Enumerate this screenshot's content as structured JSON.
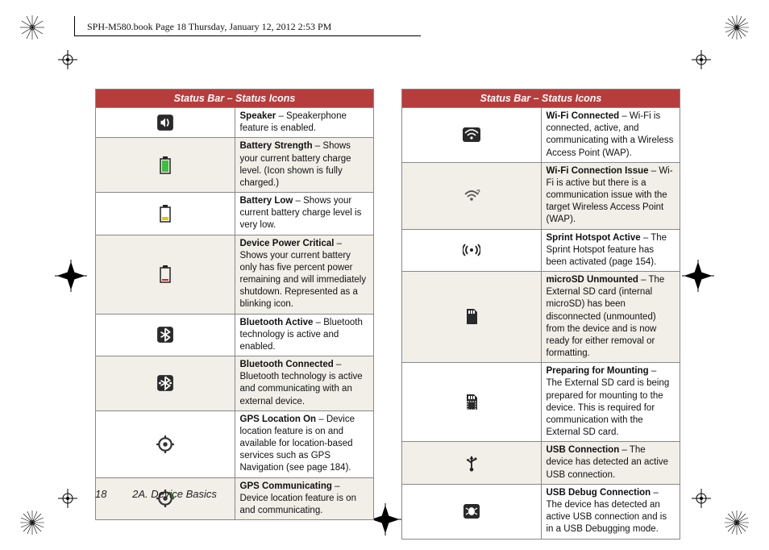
{
  "doc_tag": "SPH-M580.book  Page 18  Thursday, January 12, 2012  2:53 PM",
  "page_number": "18",
  "section": "2A. Device Basics",
  "table_header": "Status Bar – Status Icons",
  "left_rows": [
    {
      "term": "Speaker",
      "desc": " – Speakerphone feature is enabled.",
      "alt": false,
      "icon": "speaker"
    },
    {
      "term": "Battery Strength",
      "desc": " – Shows your current battery charge level. (Icon shown is fully charged.)",
      "alt": true,
      "icon": "batt-full"
    },
    {
      "term": "Battery Low",
      "desc": " – Shows your current battery charge level is very low.",
      "alt": false,
      "icon": "batt-low"
    },
    {
      "term": "Device Power Critical",
      "desc": " – Shows your current battery only has five percent power remaining and will immediately shutdown. Represented as a blinking icon.",
      "alt": true,
      "icon": "batt-crit"
    },
    {
      "term": "Bluetooth Active",
      "desc": " – Bluetooth technology is active and enabled.",
      "alt": false,
      "icon": "bt"
    },
    {
      "term": "Bluetooth Connected",
      "desc": " – Bluetooth technology is active and communicating with an external device.",
      "alt": true,
      "icon": "bt-conn"
    },
    {
      "term": "GPS Location On",
      "desc": " – Device location feature is on and available for location-based services such as GPS Navigation (see page 184).",
      "alt": false,
      "icon": "gps"
    },
    {
      "term": "GPS Communicating",
      "desc": " – Device location feature is on and communicating.",
      "alt": true,
      "icon": "gps-comm"
    }
  ],
  "right_rows": [
    {
      "term": "Wi-Fi Connected",
      "desc": " – Wi-Fi is connected, active, and communicating with a Wireless Access Point (WAP).",
      "alt": false,
      "icon": "wifi"
    },
    {
      "term": "Wi-Fi Connection Issue",
      "desc": " – Wi-Fi is active but there is a communication issue with the target Wireless Access Point (WAP).",
      "alt": true,
      "icon": "wifi-issue"
    },
    {
      "term": "Sprint Hotspot Active",
      "desc": " – The Sprint Hotspot feature has been activated (page 154).",
      "alt": false,
      "icon": "hotspot"
    },
    {
      "term": "microSD Unmounted",
      "desc": " – The External SD card (internal microSD) has been disconnected (unmounted) from the device and is now ready for either removal or formatting.",
      "alt": true,
      "icon": "sd"
    },
    {
      "term": "Preparing for Mounting",
      "desc": " – The External SD card is being prepared for mounting to the device. This is required for communication with the External SD card.",
      "alt": false,
      "icon": "sd-prep"
    },
    {
      "term": "USB Connection",
      "desc": " – The device has detected an active USB connection.",
      "alt": true,
      "icon": "usb"
    },
    {
      "term": "USB Debug Connection",
      "desc": " – The device has detected an active USB connection and is in a USB Debugging mode.",
      "alt": false,
      "icon": "usb-debug"
    }
  ]
}
